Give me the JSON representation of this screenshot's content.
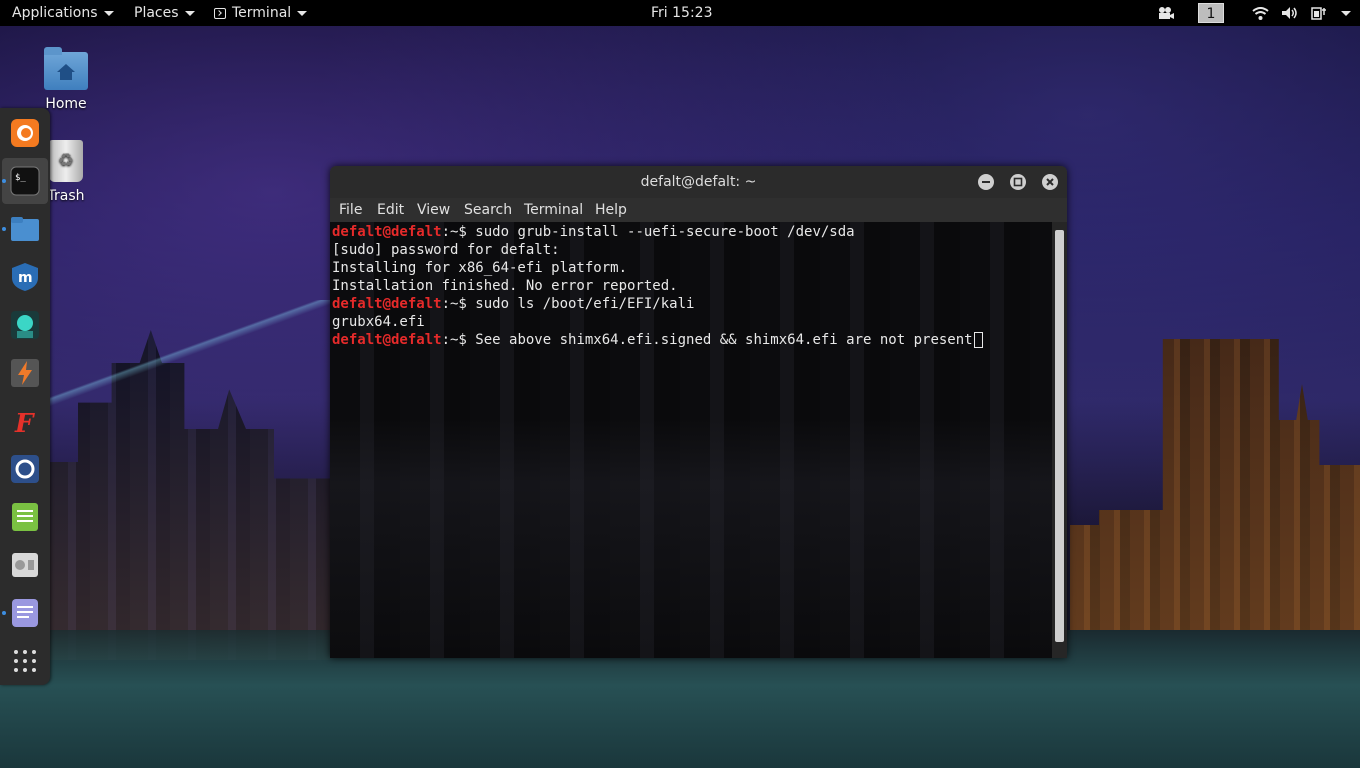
{
  "topbar": {
    "applications": "Applications",
    "places": "Places",
    "terminal": "Terminal",
    "clock": "Fri 15:23",
    "workspace": "1"
  },
  "desktop": {
    "home_label": "Home",
    "trash_label": "Trash"
  },
  "dock": {
    "items": [
      "firefox-icon",
      "terminal-icon",
      "files-icon",
      "metasploit-icon",
      "armitage-icon",
      "burpsuite-icon",
      "faraday-icon",
      "maltego-icon",
      "leafpad-icon",
      "cherrytree-icon",
      "text-editor-icon",
      "show-applications-icon"
    ]
  },
  "terminal": {
    "title": "defalt@defalt: ~",
    "menu": {
      "file": "File",
      "edit": "Edit",
      "view": "View",
      "search": "Search",
      "terminal": "Terminal",
      "help": "Help"
    },
    "prompt_user": "defalt@defalt",
    "prompt_suffix": ":~$ ",
    "lines": {
      "cmd1": "sudo grub-install --uefi-secure-boot /dev/sda",
      "out1": "[sudo] password for defalt:",
      "out2": "Installing for x86_64-efi platform.",
      "out3": "Installation finished. No error reported.",
      "cmd2": "sudo ls /boot/efi/EFI/kali",
      "out4": "grubx64.efi",
      "cmd3": "See above shimx64.efi.signed && shimx64.efi are not present"
    }
  },
  "colors": {
    "prompt": "#e52a2a",
    "terminal_text": "#e8e8e8",
    "topbar_bg": "#000000",
    "dock_bg": "#2c2c2c"
  }
}
